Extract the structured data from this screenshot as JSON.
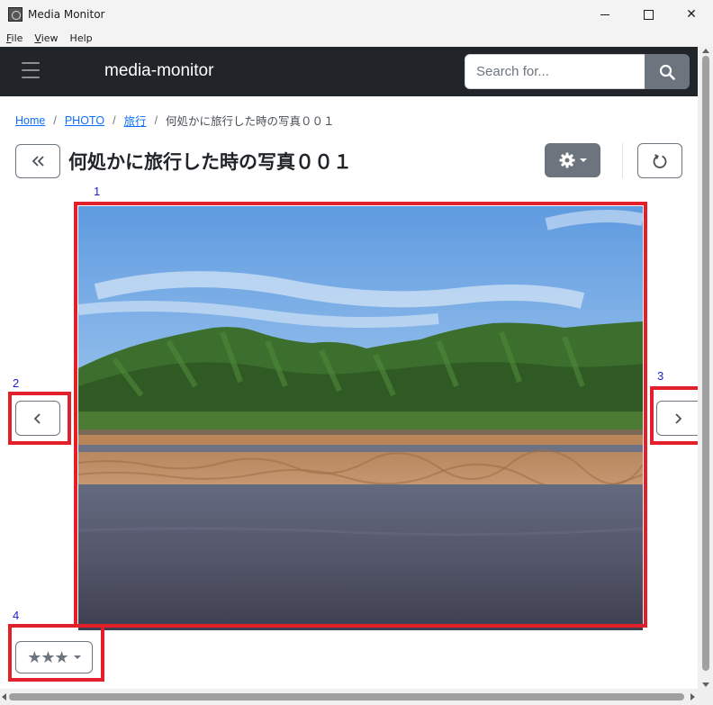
{
  "window": {
    "title": "Media Monitor",
    "close_glyph": "✕"
  },
  "menu": {
    "items": [
      {
        "label": "File",
        "mnemonic": "F",
        "rest": "ile"
      },
      {
        "label": "View",
        "mnemonic": "V",
        "rest": "iew"
      },
      {
        "label": "Help",
        "mnemonic": "",
        "rest": "Help"
      }
    ]
  },
  "navbar": {
    "brand": "media-monitor",
    "search_placeholder": "Search for...",
    "icons": {
      "menu": "hamburger-icon",
      "search": "search-icon"
    }
  },
  "breadcrumb": {
    "items": [
      "Home",
      "PHOTO",
      "旅行"
    ],
    "separator": "/",
    "current": "何処かに旅行した時の写真００１"
  },
  "header": {
    "title": "何処かに旅行した時の写真００１",
    "icons": {
      "back": "double-chevron-left-icon",
      "settings": "gear-icon",
      "refresh": "refresh-icon"
    }
  },
  "viewer": {
    "photo_description": "mountain-river-landscape-photo",
    "icons": {
      "prev": "chevron-left-icon",
      "next": "chevron-right-icon"
    }
  },
  "rating": {
    "stars": "★★★",
    "value": 3
  },
  "annotations": [
    "1",
    "2",
    "3",
    "4"
  ],
  "colors": {
    "navbar_bg": "#212529",
    "secondary": "#6c757d",
    "link": "#0d6efd",
    "annotation_box": "#e3202a",
    "annotation_label": "#2020d0"
  }
}
